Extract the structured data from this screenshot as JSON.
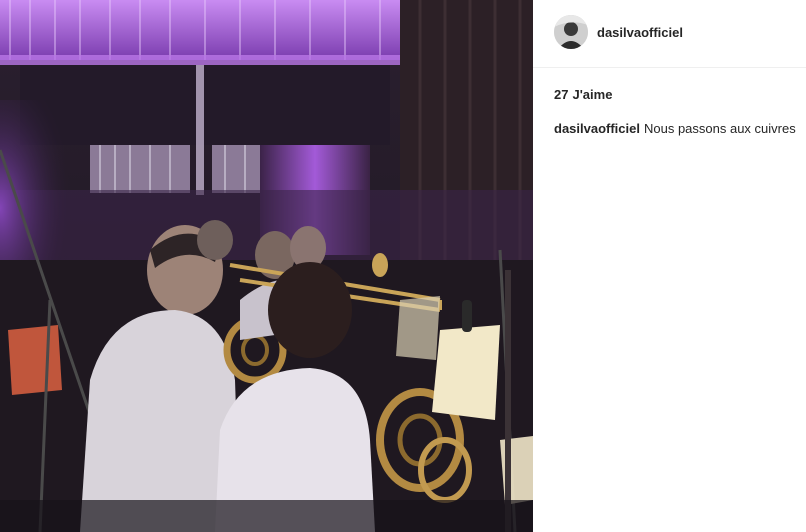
{
  "post": {
    "photo_icon": "photo-of-brass-section-recording",
    "author": {
      "username": "dasilvaofficiel",
      "avatar_icon": "avatar-icon"
    },
    "likes": {
      "count": "27",
      "label": "J'aime"
    },
    "caption": {
      "username": "dasilvaofficiel",
      "text": "Nous passons aux cuivres"
    }
  },
  "colors": {
    "text": "#262626",
    "divider": "#efefef",
    "background": "#ffffff",
    "stage_purple": "#9b4fd0"
  }
}
